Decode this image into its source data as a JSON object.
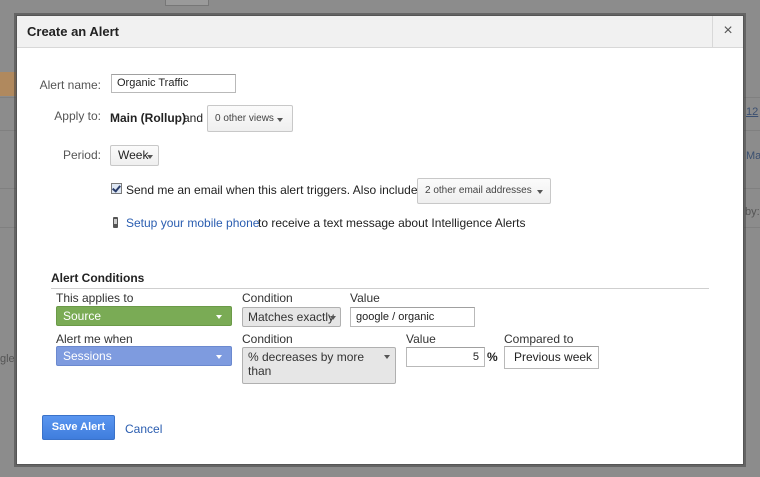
{
  "background": {
    "fragments": [
      "12",
      "Ma",
      "by:",
      "gle"
    ]
  },
  "dialog": {
    "title": "Create an Alert",
    "close_symbol": "×"
  },
  "form": {
    "alert_name_label": "Alert name:",
    "alert_name_value": "Organic Traffic",
    "apply_to_label": "Apply to:",
    "apply_to_view": "Main (Rollup)",
    "apply_to_and": "and",
    "other_views": "0 other views",
    "period_label": "Period:",
    "period_value": "Week",
    "email_checked": true,
    "email_text": "Send me an email when this alert triggers. Also include",
    "email_addresses": "2 other email addresses",
    "mobile_link": "Setup your mobile phone",
    "mobile_text": "to receive a text message about Intelligence Alerts"
  },
  "conditions": {
    "title": "Alert Conditions",
    "applies_to_label": "This applies to",
    "applies_to_value": "Source",
    "condition_label": "Condition",
    "condition_value": "Matches exactly",
    "value_label": "Value",
    "value_value": "google / organic",
    "alert_when_label": "Alert me when",
    "alert_when_value": "Sessions",
    "condition2_label": "Condition",
    "condition2_value": "% decreases by more than",
    "value2_label": "Value",
    "value2_value": "5",
    "value2_unit": "%",
    "compared_label": "Compared to",
    "compared_value": "Previous week"
  },
  "actions": {
    "save_label": "Save Alert",
    "cancel_label": "Cancel"
  },
  "colors": {
    "source_select": "#7aab55",
    "metric_select": "#7e9bdf",
    "save_button": "#4a88e6",
    "link": "#2a5db0"
  }
}
